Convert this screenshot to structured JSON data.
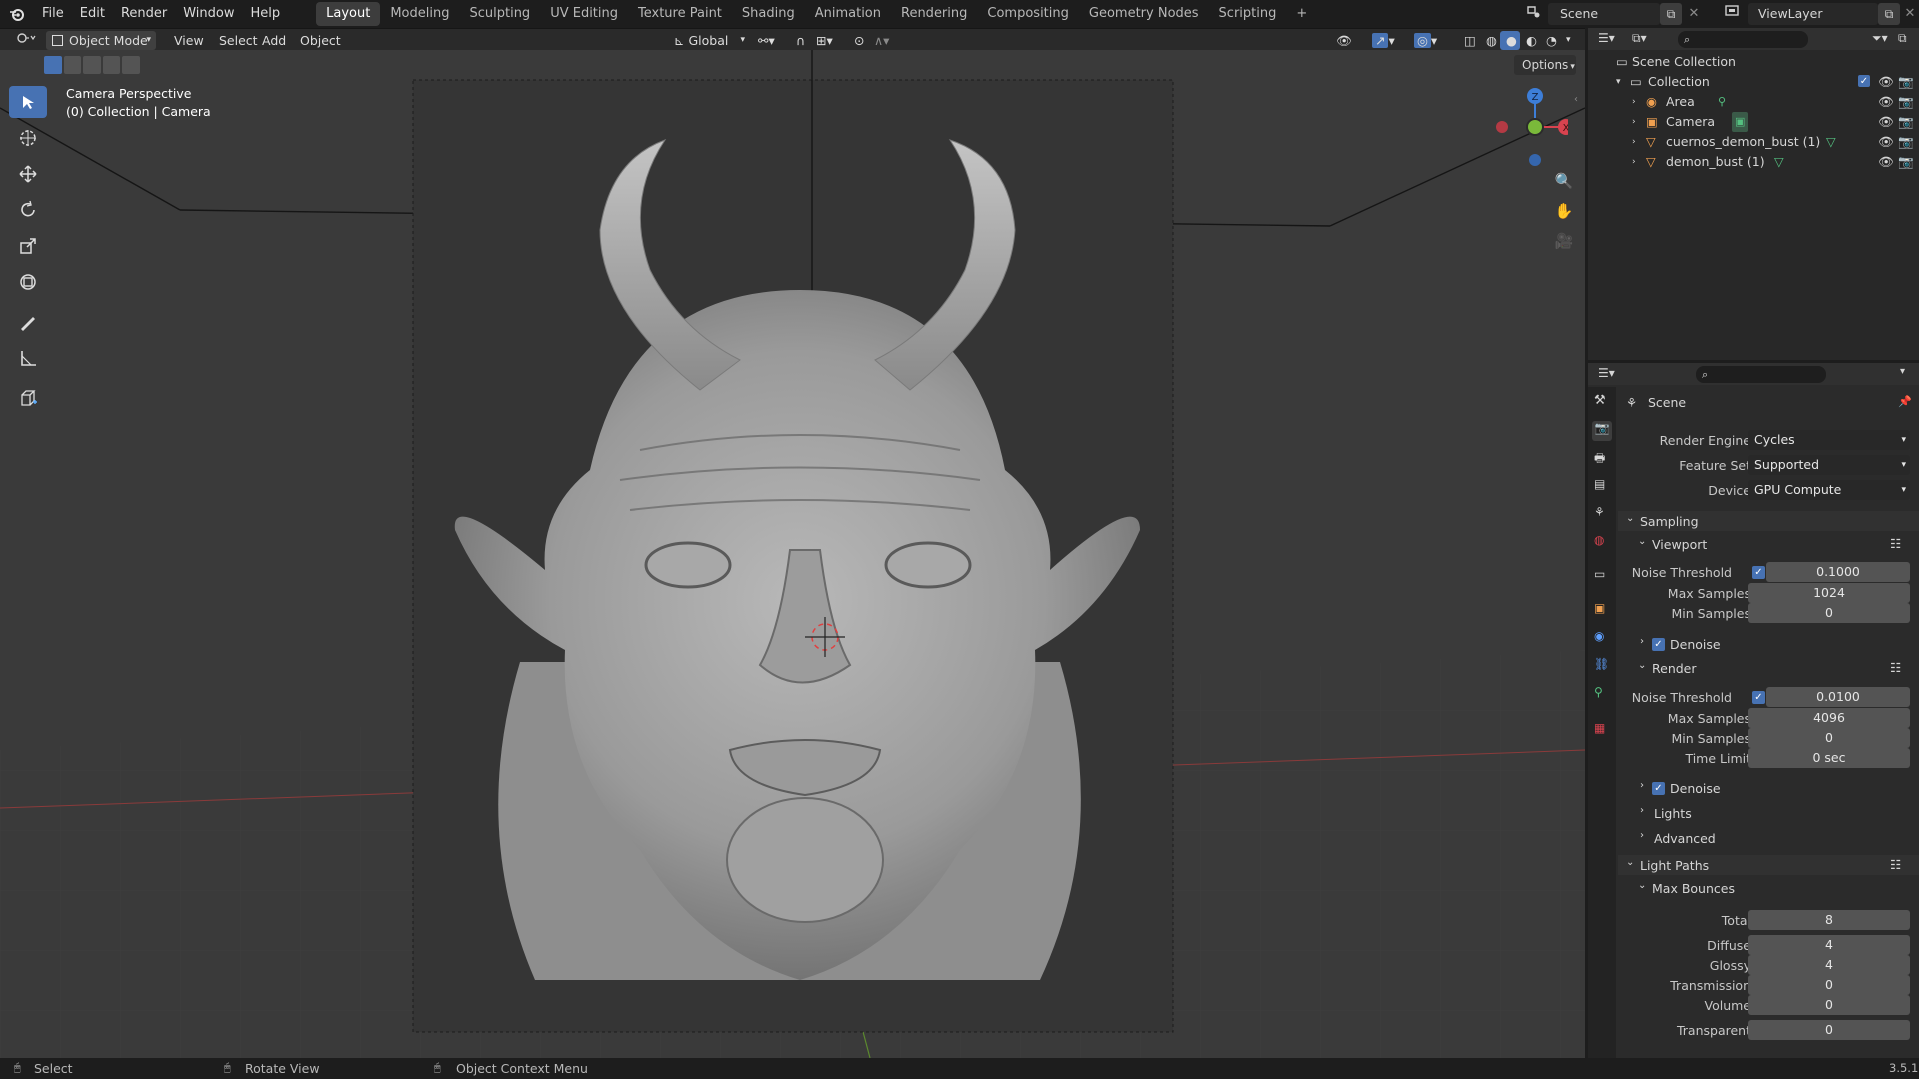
{
  "topbar": {
    "menus": [
      "File",
      "Edit",
      "Render",
      "Window",
      "Help"
    ],
    "workspaces": [
      "Layout",
      "Modeling",
      "Sculpting",
      "UV Editing",
      "Texture Paint",
      "Shading",
      "Animation",
      "Rendering",
      "Compositing",
      "Geometry Nodes",
      "Scripting"
    ],
    "active_workspace": "Layout",
    "add_tab": "+",
    "scene_name": "Scene",
    "view_layer": "ViewLayer"
  },
  "viewport_header": {
    "mode": "Object Mode",
    "menus": [
      "View",
      "Select",
      "Add",
      "Object"
    ],
    "transform_orientation": "Global",
    "options": "Options"
  },
  "viewport": {
    "view_name": "Camera Perspective",
    "collection_info": "(0) Collection | Camera",
    "gizmo": {
      "x": "X",
      "y": "Y",
      "z": "Z"
    },
    "colors": {
      "background": "#3a3a3a",
      "accent": "#4772b3",
      "x_axis": "#d9434f",
      "y_axis": "#7ab93a",
      "z_axis": "#3d7ed8"
    }
  },
  "outliner": {
    "root": "Scene Collection",
    "collection": "Collection",
    "items": [
      {
        "name": "Area",
        "icon": "light-icon"
      },
      {
        "name": "Camera",
        "icon": "camera-icon"
      },
      {
        "name": "cuernos_demon_bust (1)",
        "icon": "mesh-icon"
      },
      {
        "name": "demon_bust (1)",
        "icon": "mesh-icon"
      }
    ]
  },
  "properties": {
    "context": "Scene",
    "render_engine_label": "Render Engine",
    "render_engine": "Cycles",
    "feature_set_label": "Feature Set",
    "feature_set": "Supported",
    "device_label": "Device",
    "device": "GPU Compute",
    "sampling": {
      "title": "Sampling",
      "viewport": {
        "title": "Viewport",
        "noise_threshold_label": "Noise Threshold",
        "noise_threshold": "0.1000",
        "max_samples_label": "Max Samples",
        "max_samples": "1024",
        "min_samples_label": "Min Samples",
        "min_samples": "0",
        "denoise": "Denoise"
      },
      "render": {
        "title": "Render",
        "noise_threshold_label": "Noise Threshold",
        "noise_threshold": "0.0100",
        "max_samples_label": "Max Samples",
        "max_samples": "4096",
        "min_samples_label": "Min Samples",
        "min_samples": "0",
        "time_limit_label": "Time Limit",
        "time_limit": "0 sec",
        "denoise": "Denoise"
      },
      "lights": "Lights",
      "advanced": "Advanced"
    },
    "light_paths": {
      "title": "Light Paths",
      "max_bounces": "Max Bounces",
      "rows": [
        {
          "label": "Total",
          "value": "8"
        },
        {
          "label": "Diffuse",
          "value": "4"
        },
        {
          "label": "Glossy",
          "value": "4"
        },
        {
          "label": "Transmission",
          "value": "0"
        },
        {
          "label": "Volume",
          "value": "0"
        },
        {
          "label": "Transparent",
          "value": "0"
        }
      ]
    }
  },
  "statusbar": {
    "select": "Select",
    "rotate": "Rotate View",
    "context_menu": "Object Context Menu",
    "version": "3.5.1"
  }
}
